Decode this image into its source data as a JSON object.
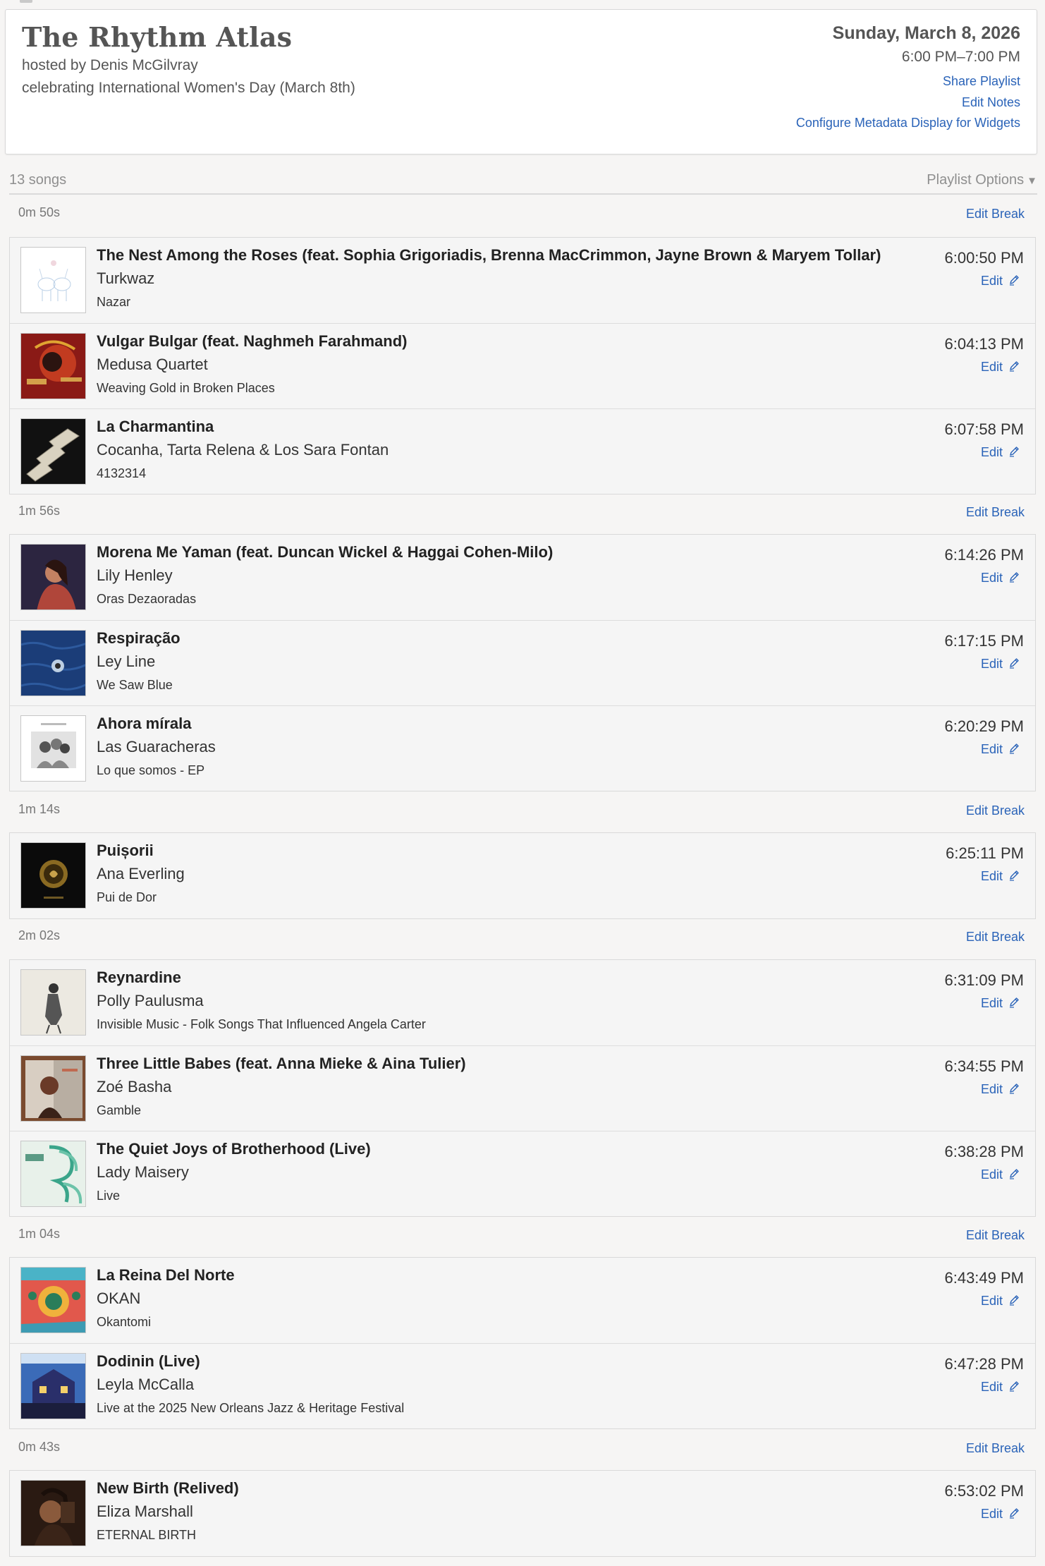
{
  "header": {
    "title": "The Rhythm Atlas",
    "host": "hosted by Denis McGilvray",
    "description": "celebrating International Women's Day (March 8th)",
    "date": "Sunday, March 8, 2026",
    "time_range": "6:00 PM–7:00 PM",
    "links": [
      "Share Playlist",
      "Edit Notes",
      "Configure Metadata Display for Widgets"
    ]
  },
  "toolbar": {
    "song_count": "13 songs",
    "options_label": "Playlist Options",
    "options_caret": "▼"
  },
  "labels": {
    "edit_break": "Edit Break",
    "edit": "Edit"
  },
  "breaks": [
    "0m 50s",
    "1m 56s",
    "1m 14s",
    "2m 02s",
    "1m 04s",
    "0m 43s"
  ],
  "songs": [
    {
      "title": "The Nest Among the Roses (feat. Sophia Grigoriadis, Brenna MacCrimmon, Jayne Brown & Maryem Tollar)",
      "artist": "Turkwaz",
      "album": "Nazar",
      "time": "6:00:50 PM",
      "art_icon": "deer-art"
    },
    {
      "title": "Vulgar Bulgar (feat. Naghmeh Farahmand)",
      "artist": "Medusa Quartet",
      "album": "Weaving Gold in Broken Places",
      "time": "6:04:13 PM",
      "art_icon": "red-face-art"
    },
    {
      "title": "La Charmantina",
      "artist": "Cocanha, Tarta Relena & Los Sara Fontan",
      "album": "4132314",
      "time": "6:07:58 PM",
      "art_icon": "zigzag-art"
    },
    {
      "title": "Morena Me Yaman (feat. Duncan Wickel & Haggai Cohen-Milo)",
      "artist": "Lily Henley",
      "album": "Oras Dezaoradas",
      "time": "6:14:26 PM",
      "art_icon": "portrait-art"
    },
    {
      "title": "Respiração",
      "artist": "Ley Line",
      "album": "We Saw Blue",
      "time": "6:17:15 PM",
      "art_icon": "ocean-art"
    },
    {
      "title": "Ahora mírala",
      "artist": "Las Guaracheras",
      "album": "Lo que somos - EP",
      "time": "6:20:29 PM",
      "art_icon": "group-photo-art"
    },
    {
      "title": "Puișorii",
      "artist": "Ana Everling",
      "album": "Pui de Dor",
      "time": "6:25:11 PM",
      "art_icon": "gold-coin-art"
    },
    {
      "title": "Reynardine",
      "artist": "Polly Paulusma",
      "album": "Invisible Music - Folk Songs That Influenced Angela Carter",
      "time": "6:31:09 PM",
      "art_icon": "sketch-figure-art"
    },
    {
      "title": "Three Little Babes (feat. Anna Mieke & Aina Tulier)",
      "artist": "Zoé Basha",
      "album": "Gamble",
      "time": "6:34:55 PM",
      "art_icon": "framed-photo-art"
    },
    {
      "title": "The Quiet Joys of Brotherhood (Live)",
      "artist": "Lady Maisery",
      "album": "Live",
      "time": "6:38:28 PM",
      "art_icon": "green-wave-art"
    },
    {
      "title": "La Reina Del Norte",
      "artist": "OKAN",
      "album": "Okantomi",
      "time": "6:43:49 PM",
      "art_icon": "colorful-folk-art"
    },
    {
      "title": "Dodinin (Live)",
      "artist": "Leyla McCalla",
      "album": "Live at the 2025 New Orleans Jazz & Heritage Festival",
      "time": "6:47:28 PM",
      "art_icon": "house-night-art"
    },
    {
      "title": "New Birth (Relived)",
      "artist": "Eliza Marshall",
      "album": "ETERNAL BIRTH",
      "time": "6:53:02 PM",
      "art_icon": "dark-portrait-art"
    }
  ]
}
